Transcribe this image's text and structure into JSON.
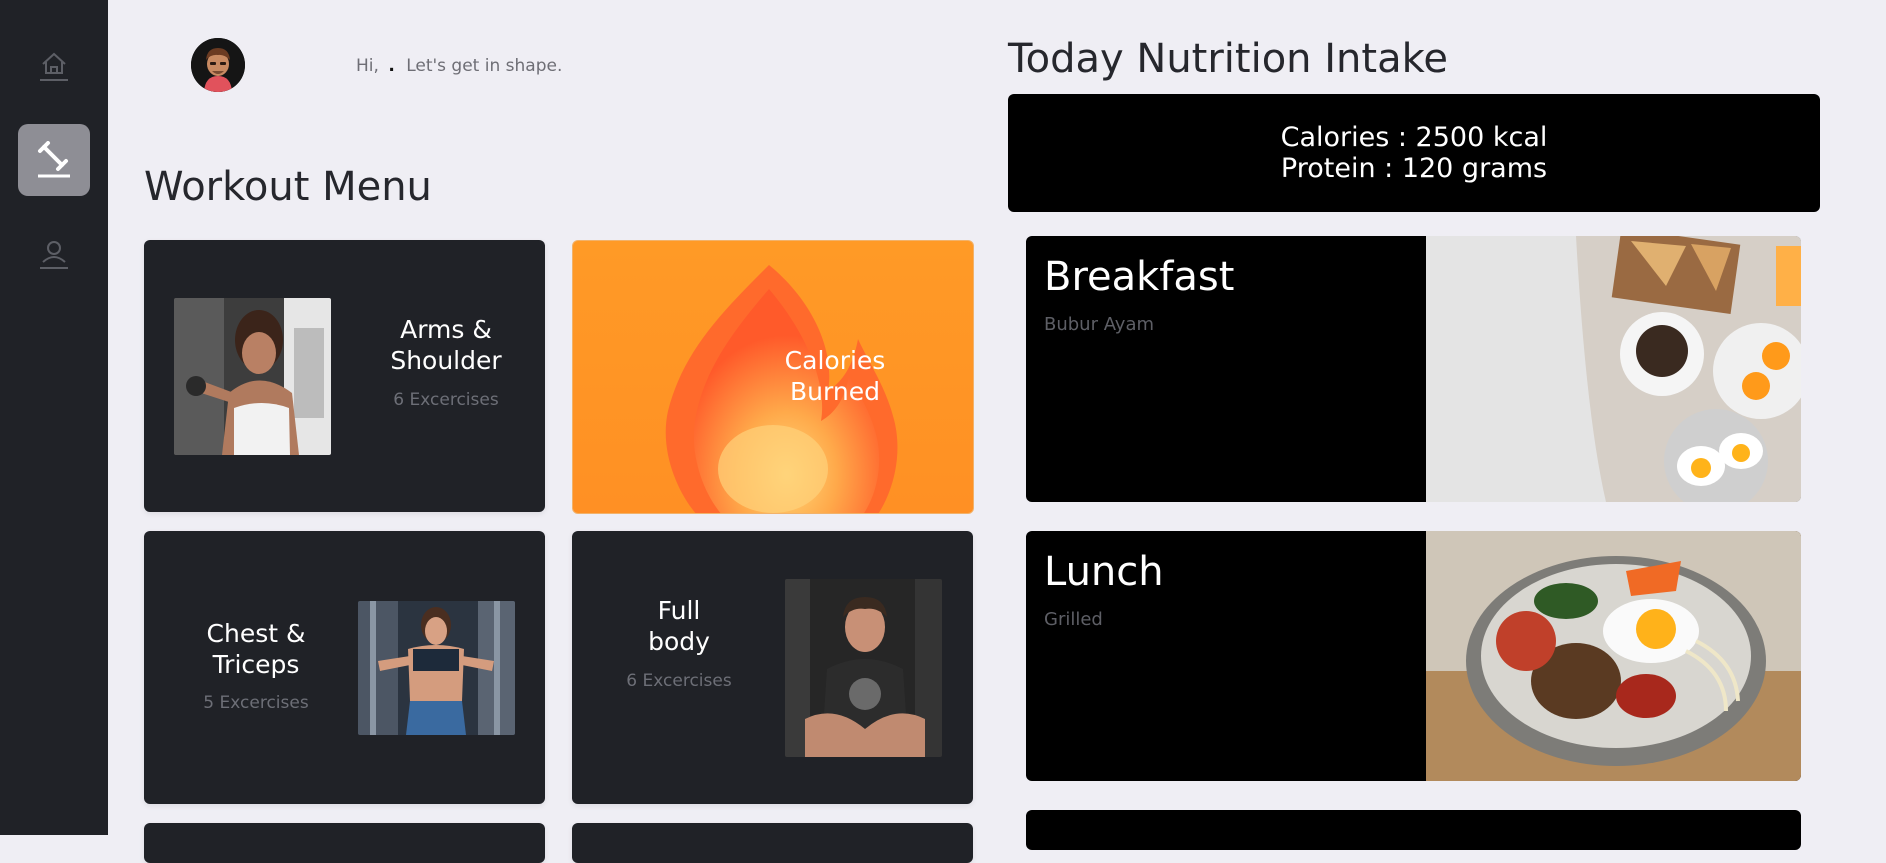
{
  "sidebar": {
    "items": [
      {
        "icon": "home-icon",
        "active": false
      },
      {
        "icon": "dumbbell-icon",
        "active": true
      },
      {
        "icon": "profile-icon",
        "active": false
      }
    ]
  },
  "header": {
    "greeting_prefix": "Hi,",
    "user_name": ".",
    "greeting_suffix": "Let's get in shape."
  },
  "workout": {
    "title": "Workout Menu",
    "cards": [
      {
        "title": "Arms &\nShoulder",
        "subtitle": "6 Excercises"
      },
      {
        "title": "Calories\nBurned"
      },
      {
        "title": "Chest &\nTriceps",
        "subtitle": "5 Excercises"
      },
      {
        "title": "Full\nbody",
        "subtitle": "6 Excercises"
      }
    ]
  },
  "nutrition": {
    "title": "Today Nutrition Intake",
    "calories": "Calories : 2500 kcal",
    "protein": "Protein : 120 grams",
    "meals": [
      {
        "title": "Breakfast",
        "item": "Bubur Ayam"
      },
      {
        "title": "Lunch",
        "item": "Grilled"
      }
    ]
  },
  "colors": {
    "sidebar_bg": "#202227",
    "card_bg": "#202227",
    "accent_orange": "#ff9a26",
    "page_bg": "#efeef4"
  }
}
